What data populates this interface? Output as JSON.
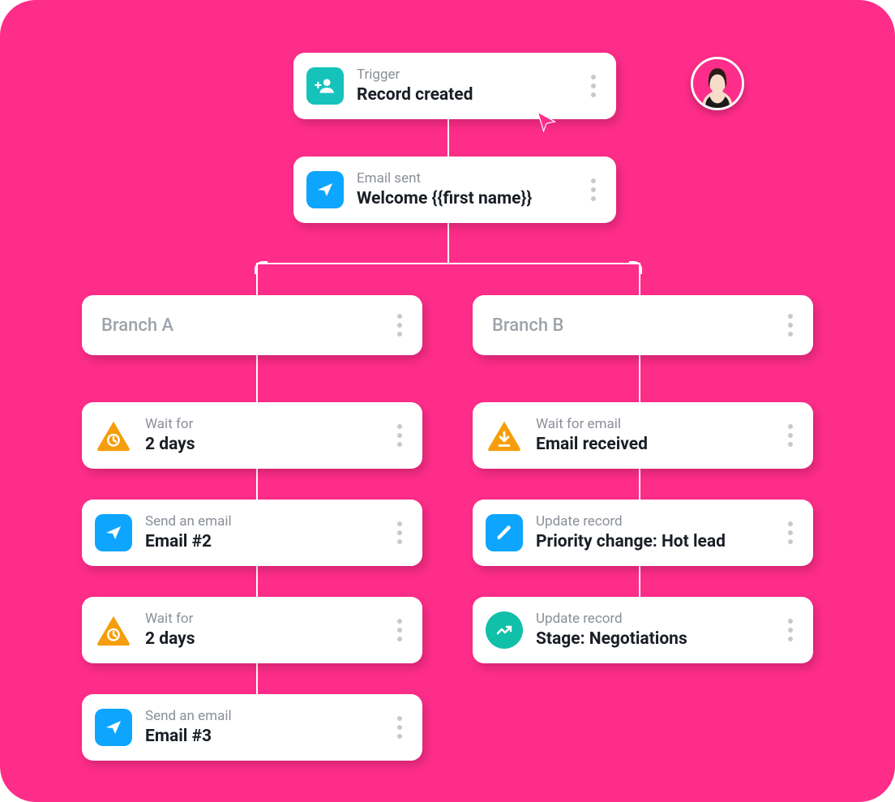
{
  "colors": {
    "bg": "#ff2d8a",
    "teal": "#15c3bb",
    "blue": "#0ea5ff",
    "orange": "#f59e0b",
    "tealg": "#11c0a9"
  },
  "avatar": {
    "present": true
  },
  "nodes": {
    "trigger": {
      "eyebrow": "Trigger",
      "title": "Record created",
      "icon": "user-add-icon",
      "iconColor": "teal"
    },
    "email1": {
      "eyebrow": "Email sent",
      "title": "Welcome {{first name}}",
      "icon": "send-icon",
      "iconColor": "blue"
    },
    "branchA": {
      "label": "Branch A"
    },
    "branchB": {
      "label": "Branch B"
    },
    "a1": {
      "eyebrow": "Wait for",
      "title": "2 days",
      "icon": "clock-icon",
      "iconColor": "orange"
    },
    "a2": {
      "eyebrow": "Send an email",
      "title": "Email #2",
      "icon": "send-icon",
      "iconColor": "blue"
    },
    "a3": {
      "eyebrow": "Wait for",
      "title": "2 days",
      "icon": "clock-icon",
      "iconColor": "orange"
    },
    "a4": {
      "eyebrow": "Send an email",
      "title": "Email #3",
      "icon": "send-icon",
      "iconColor": "blue"
    },
    "b1": {
      "eyebrow": "Wait for email",
      "title": "Email received",
      "icon": "download-icon",
      "iconColor": "orange"
    },
    "b2": {
      "eyebrow": "Update record",
      "title": "Priority change: Hot lead",
      "icon": "pencil-icon",
      "iconColor": "blue"
    },
    "b3": {
      "eyebrow": "Update record",
      "title": "Stage: Negotiations",
      "icon": "trend-icon",
      "iconColor": "tealg"
    }
  }
}
